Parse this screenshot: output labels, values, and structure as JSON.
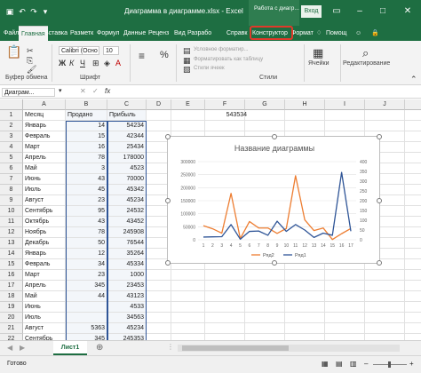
{
  "window": {
    "title": "Диаграмма в диаграмме.xlsx - Excel",
    "context_group": "Работа с диагр...",
    "sign_in": "Вход"
  },
  "tabs": [
    "Файл",
    "Главная",
    "Вставка",
    "Разметк",
    "Формул",
    "Данные",
    "Реценз",
    "Вид",
    "Разрабо",
    "Справк",
    "Конструктор",
    "Формат"
  ],
  "tell_me": "Помощ",
  "share": "🔒",
  "ribbon": {
    "font_name": "Calibri (Осно",
    "font_size": "10",
    "clipboard_label": "Буфер обмена",
    "font_label": "Шрифт",
    "styles_label": "Стили",
    "cond_format": "Условное форматир...",
    "format_table": "Форматировать как таблицу",
    "cell_styles": "Стили ячеек",
    "cells_btn": "Ячейки",
    "editing_btn": "Редактирование"
  },
  "formula_bar": {
    "name_box": "Диаграм...",
    "fx": "fx"
  },
  "columns": [
    "A",
    "B",
    "C",
    "D",
    "E",
    "F",
    "G",
    "H",
    "I",
    "J",
    "K",
    "L"
  ],
  "rows": [
    {
      "n": "1",
      "a": "Месяц",
      "b": "Продано",
      "c": "Прибыль"
    },
    {
      "n": "2",
      "a": "Январь",
      "b": "14",
      "c": "54234"
    },
    {
      "n": "3",
      "a": "Февраль",
      "b": "15",
      "c": "42344"
    },
    {
      "n": "4",
      "a": "Март",
      "b": "16",
      "c": "25434"
    },
    {
      "n": "5",
      "a": "Апрель",
      "b": "78",
      "c": "178000"
    },
    {
      "n": "6",
      "a": "Май",
      "b": "3",
      "c": "4523"
    },
    {
      "n": "7",
      "a": "Июнь",
      "b": "43",
      "c": "70000"
    },
    {
      "n": "8",
      "a": "Июль",
      "b": "45",
      "c": "45342"
    },
    {
      "n": "9",
      "a": "Август",
      "b": "23",
      "c": "45234"
    },
    {
      "n": "10",
      "a": "Сентябрь",
      "b": "95",
      "c": "24532"
    },
    {
      "n": "11",
      "a": "Октябрь",
      "b": "43",
      "c": "43452"
    },
    {
      "n": "12",
      "a": "Ноябрь",
      "b": "78",
      "c": "245908"
    },
    {
      "n": "13",
      "a": "Декабрь",
      "b": "50",
      "c": "76544"
    },
    {
      "n": "14",
      "a": "Январь",
      "b": "12",
      "c": "35264"
    },
    {
      "n": "15",
      "a": "Февраль",
      "b": "34",
      "c": "45334"
    },
    {
      "n": "16",
      "a": "Март",
      "b": "23",
      "c": "1000"
    },
    {
      "n": "17",
      "a": "Апрель",
      "b": "345",
      "c": "23453"
    },
    {
      "n": "18",
      "a": "Май",
      "b": "44",
      "c": "43123"
    },
    {
      "n": "19",
      "a": "Июнь",
      "b": "",
      "c": "4533"
    },
    {
      "n": "20",
      "a": "Июль",
      "b": "",
      "c": "34563"
    },
    {
      "n": "21",
      "a": "Август",
      "b": "5363",
      "c": "45234"
    },
    {
      "n": "22",
      "a": "Сентябрь",
      "b": "345",
      "c": "245353"
    },
    {
      "n": "23",
      "a": "Октябрь",
      "b": "35",
      "c": "4534"
    },
    {
      "n": "24",
      "a": "Ноябрь",
      "b": "23",
      "c": "1453"
    }
  ],
  "e1_value": "543534",
  "sheet_tab": "Лист1",
  "status_text": "Готово",
  "zoom": "",
  "colors": {
    "excel_green": "#1e6e42",
    "series1": "#ed7d31",
    "series2": "#2f5597",
    "highlight": "#e03a2a"
  },
  "chart_data": {
    "type": "line",
    "title": "Название диаграммы",
    "x": [
      1,
      2,
      3,
      4,
      5,
      6,
      7,
      8,
      9,
      10,
      11,
      12,
      13,
      14,
      15,
      16,
      17
    ],
    "series": [
      {
        "name": "Ряд2",
        "axis": "left",
        "values": [
          54234,
          42344,
          25434,
          178000,
          4523,
          70000,
          45342,
          45234,
          24532,
          43452,
          245908,
          76544,
          35264,
          45334,
          1000,
          23453,
          43123
        ]
      },
      {
        "name": "Ряд1",
        "axis": "right",
        "values": [
          14,
          15,
          16,
          78,
          3,
          43,
          45,
          23,
          95,
          43,
          78,
          50,
          12,
          34,
          23,
          345,
          44
        ]
      }
    ],
    "y_left": {
      "ticks": [
        "0",
        "50000",
        "100000",
        "150000",
        "200000",
        "250000",
        "300000"
      ],
      "max": 300000
    },
    "y_right": {
      "ticks": [
        "0",
        "50",
        "100",
        "150",
        "200",
        "250",
        "300",
        "350",
        "400"
      ],
      "max": 400
    },
    "legend_position": "bottom"
  }
}
